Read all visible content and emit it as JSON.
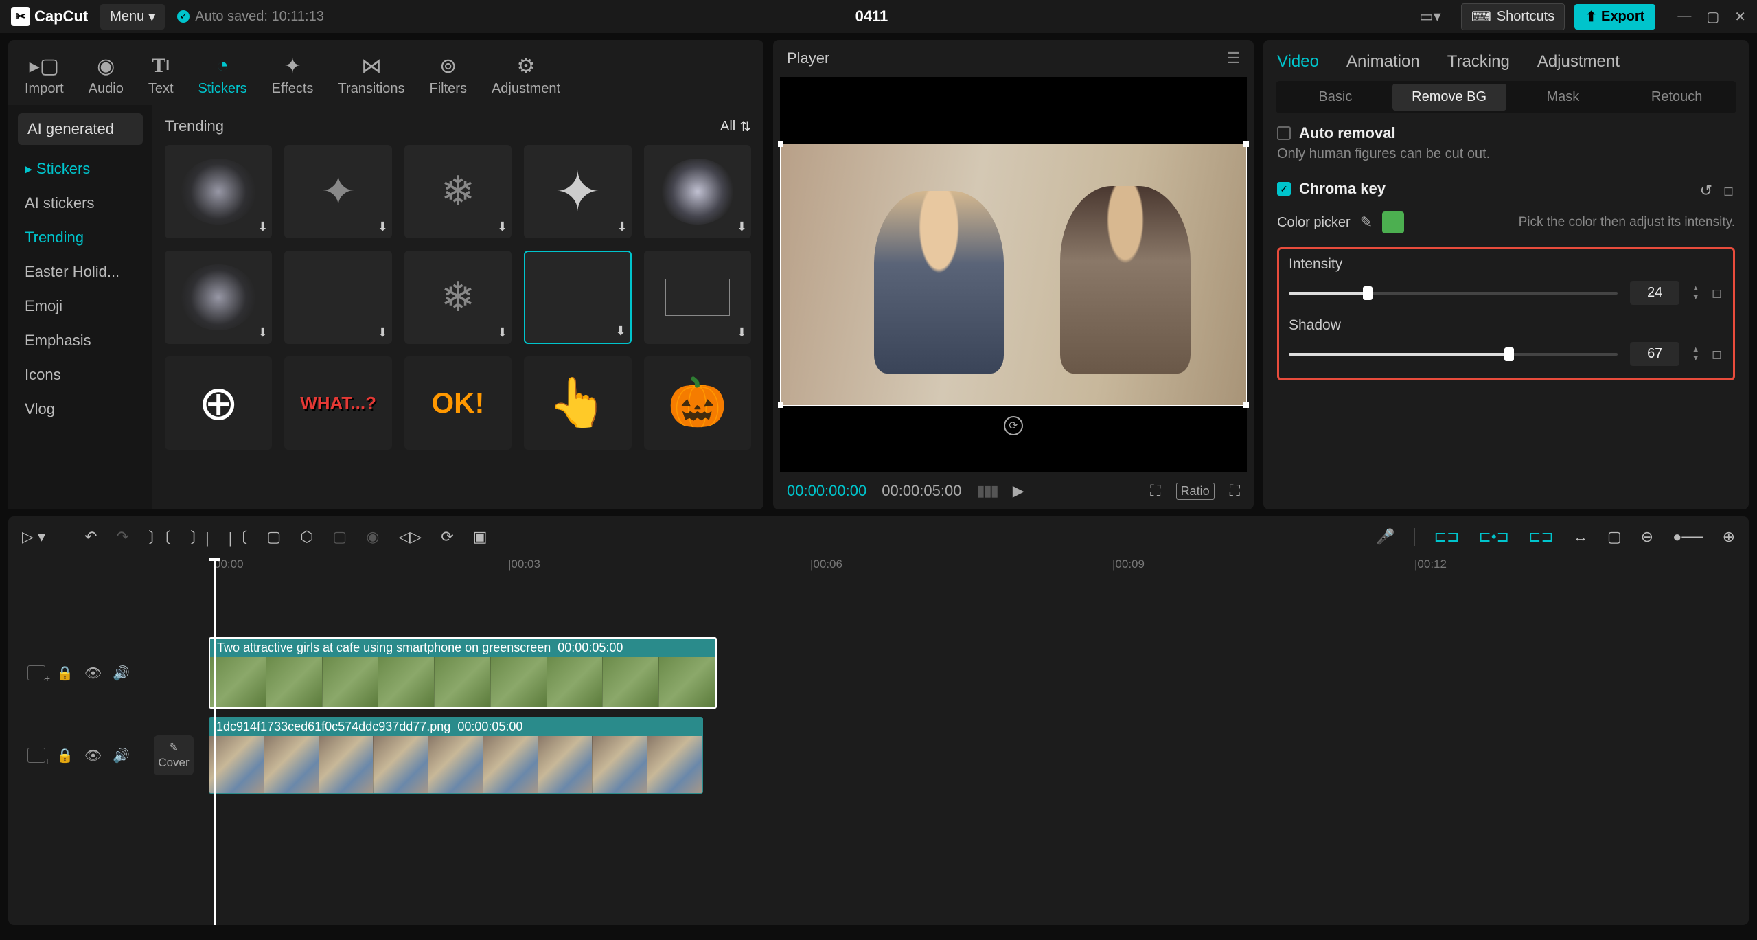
{
  "titlebar": {
    "app": "CapCut",
    "menu": "Menu",
    "autosave": "Auto saved: 10:11:13",
    "project": "0411",
    "shortcuts": "Shortcuts",
    "export": "Export"
  },
  "mediaTabs": [
    "Import",
    "Audio",
    "Text",
    "Stickers",
    "Effects",
    "Transitions",
    "Filters",
    "Adjustment"
  ],
  "mediaTabActive": "Stickers",
  "categories": {
    "header": "AI generated",
    "items": [
      "Stickers",
      "AI stickers",
      "Trending",
      "Easter Holid...",
      "Emoji",
      "Emphasis",
      "Icons",
      "Vlog"
    ],
    "active": "Trending",
    "parent": "Stickers"
  },
  "grid": {
    "title": "Trending",
    "filter": "All"
  },
  "player": {
    "title": "Player",
    "currentTime": "00:00:00:00",
    "duration": "00:00:05:00",
    "ratio": "Ratio"
  },
  "props": {
    "tabs": [
      "Video",
      "Animation",
      "Tracking",
      "Adjustment"
    ],
    "tabActive": "Video",
    "subtabs": [
      "Basic",
      "Remove BG",
      "Mask",
      "Retouch"
    ],
    "subtabActive": "Remove BG",
    "autoRemoval": {
      "label": "Auto removal",
      "note": "Only human figures can be cut out."
    },
    "chroma": {
      "label": "Chroma key",
      "pickerLabel": "Color picker",
      "hint": "Pick the color then adjust its intensity.",
      "swatch": "#4caf50",
      "intensity": {
        "label": "Intensity",
        "value": "24",
        "pct": 24
      },
      "shadow": {
        "label": "Shadow",
        "value": "67",
        "pct": 67
      }
    }
  },
  "timeline": {
    "ruler": [
      "00:00",
      "|00:03",
      "|00:06",
      "|00:09",
      "|00:12"
    ],
    "clip1": {
      "title": "Two attractive girls at cafe using smartphone on greenscreen",
      "dur": "00:00:05:00"
    },
    "clip2": {
      "title": "1dc914f1733ced61f0c574ddc937dd77.png",
      "dur": "00:00:05:00"
    },
    "cover": "Cover"
  }
}
